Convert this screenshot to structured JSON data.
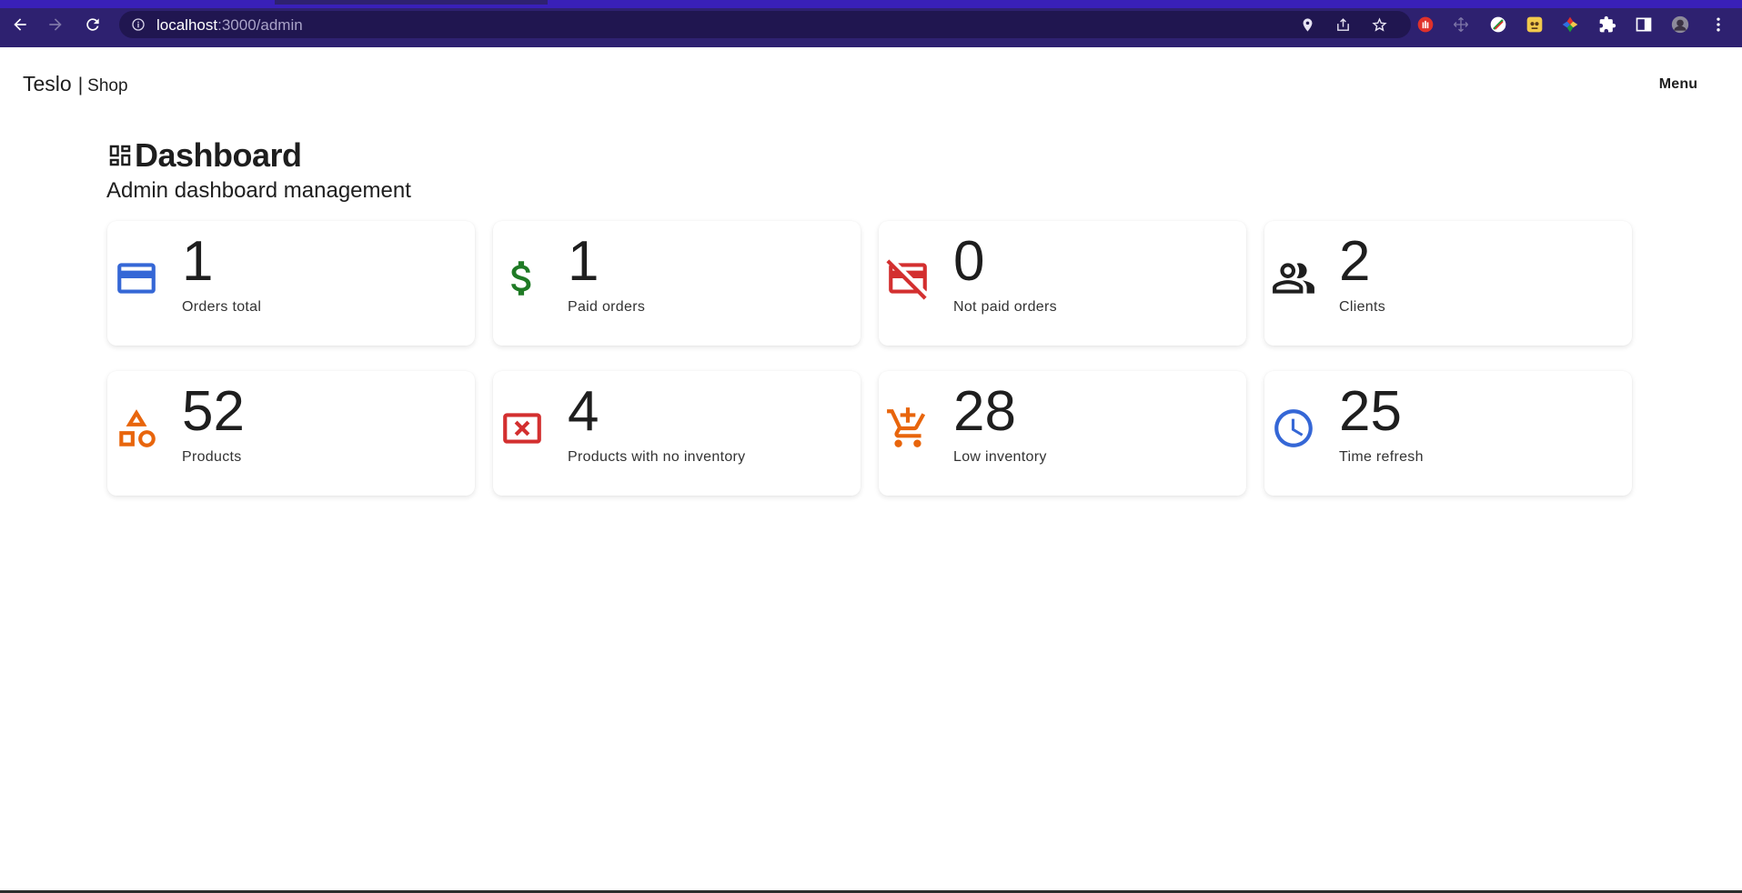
{
  "browser": {
    "url_host": "localhost",
    "url_rest": ":3000/admin",
    "colors": {
      "frame": "#2e2170",
      "top_bar": "#3920b8",
      "omnibox": "#201650"
    }
  },
  "header": {
    "brand": "Teslo",
    "separator": "|",
    "brand_sub": "Shop",
    "menu_label": "Menu"
  },
  "page": {
    "title": "Dashboard",
    "subtitle": "Admin dashboard management"
  },
  "cards": [
    {
      "value": "1",
      "label": "Orders total",
      "icon": "credit-card-icon",
      "color": "#3567d6"
    },
    {
      "value": "1",
      "label": "Paid orders",
      "icon": "dollar-icon",
      "color": "#1f7a25"
    },
    {
      "value": "0",
      "label": "Not paid orders",
      "icon": "credit-card-off-icon",
      "color": "#d32f2f"
    },
    {
      "value": "2",
      "label": "Clients",
      "icon": "group-icon",
      "color": "#1e1e1e"
    },
    {
      "value": "52",
      "label": "Products",
      "icon": "category-icon",
      "color": "#e8650c"
    },
    {
      "value": "4",
      "label": "Products with no inventory",
      "icon": "cancel-box-icon",
      "color": "#d32f2f"
    },
    {
      "value": "28",
      "label": "Low inventory",
      "icon": "cart-download-icon",
      "color": "#e8650c"
    },
    {
      "value": "25",
      "label": "Time refresh",
      "icon": "clock-icon",
      "color": "#3567d6"
    }
  ]
}
